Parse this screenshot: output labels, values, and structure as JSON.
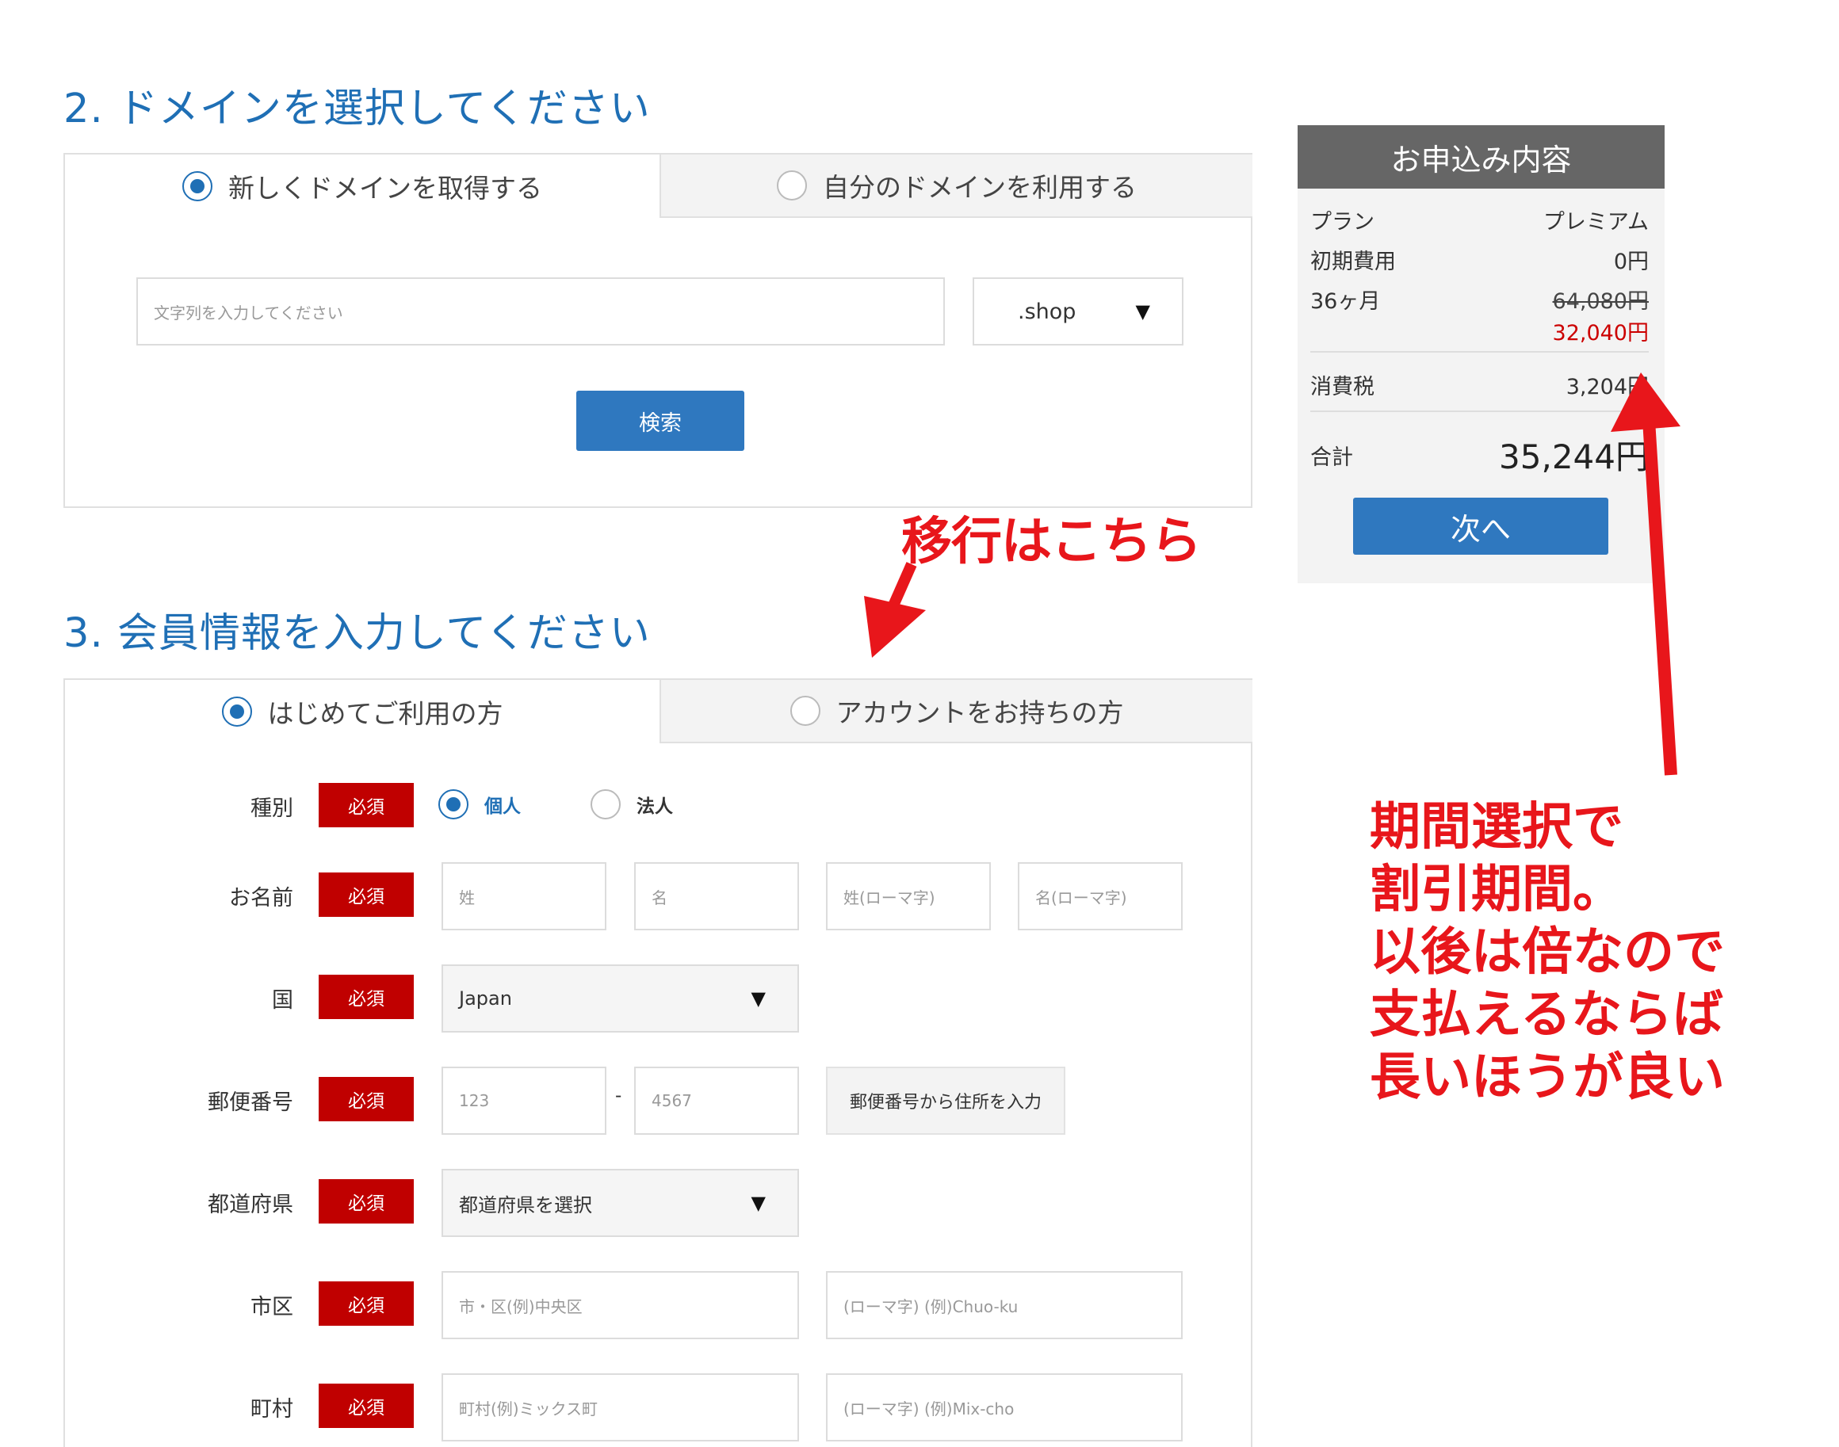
{
  "domain_section": {
    "title": "2. ドメインを選択してください",
    "tab_new": "新しくドメインを取得する",
    "tab_own": "自分のドメインを利用する",
    "input_placeholder": "文字列を入力してください",
    "tld_value": ".shop",
    "search_label": "検索"
  },
  "member_section": {
    "title": "3. 会員情報を入力してください",
    "tab_first": "はじめてご利用の方",
    "tab_account": "アカウントをお持ちの方",
    "required_label": "必須",
    "type": {
      "label": "種別",
      "opt_individual": "個人",
      "opt_corporate": "法人"
    },
    "name": {
      "label": "お名前",
      "last": "姓",
      "first": "名",
      "last_roman": "姓(ローマ字)",
      "first_roman": "名(ローマ字)"
    },
    "country": {
      "label": "国",
      "value": "Japan"
    },
    "postal": {
      "label": "郵便番号",
      "part1": "123",
      "dash": "-",
      "part2": "4567",
      "lookup": "郵便番号から住所を入力"
    },
    "prefecture": {
      "label": "都道府県",
      "value": "都道府県を選択"
    },
    "city": {
      "label": "市区",
      "placeholder": "市・区(例)中央区",
      "roman": "(ローマ字) (例)Chuo-ku"
    },
    "town": {
      "label": "町村",
      "placeholder": "町村(例)ミックス町",
      "roman": "(ローマ字) (例)Mix-cho"
    }
  },
  "summary": {
    "title": "お申込み内容",
    "plan_label": "プラン",
    "plan_value": "プレミアム",
    "initial_label": "初期費用",
    "initial_value": "0円",
    "term_label": "36ヶ月",
    "term_original": "64,080円",
    "term_discount": "32,040円",
    "tax_label": "消費税",
    "tax_value": "3,204円",
    "total_label": "合計",
    "total_value": "35,244円",
    "next_label": "次へ"
  },
  "annotations": {
    "migration": "移行はこちら",
    "note_lines": [
      "期間選択で",
      "割引期間。",
      "以後は倍なので",
      "支払えるならば",
      "長いほうが良い"
    ]
  },
  "colors": {
    "accent_blue": "#1f6fb5",
    "button_blue": "#2f78bf",
    "required_red": "#c00000",
    "annotation_red": "#e8161b",
    "discount_red": "#cc0000"
  }
}
